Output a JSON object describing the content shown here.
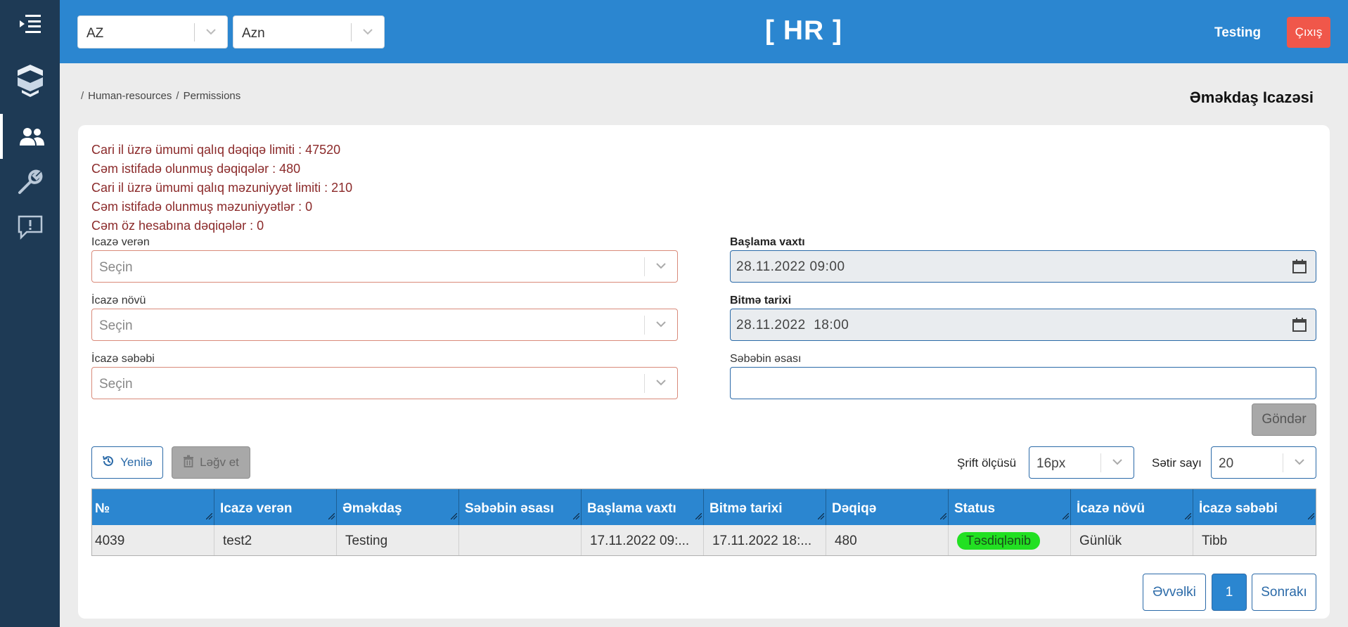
{
  "header": {
    "language_select": "AZ",
    "currency_select": "Azn",
    "title": "[ HR ]",
    "user_name": "Testing",
    "logout_label": "Çıxış"
  },
  "sidebar": {
    "icons": [
      "menu-icon",
      "logo-icon",
      "users-icon",
      "wrench-icon",
      "feedback-icon"
    ]
  },
  "breadcrumb": {
    "items": [
      "Human-resources",
      "Permissions"
    ]
  },
  "page": {
    "title": "Əməkdaş Icazəsi"
  },
  "limits": {
    "line1": "Cari il üzrə ümumi qalıq dəqiqə limiti : 47520",
    "line2": "Cəm istifadə olunmuş dəqiqələr : 480",
    "line3": "Cari il üzrə ümumi qalıq məzuniyyət limiti : 210",
    "line4": "Cəm istifadə olunmuş məzuniyyətlər : 0",
    "line5": "Cəm öz hesabına dəqiqələr : 0"
  },
  "form": {
    "permit_giver_label": "Icazə verən",
    "permit_giver_placeholder": "Seçin",
    "permit_type_label": "İcazə növü",
    "permit_type_placeholder": "Seçin",
    "permit_reason_label": "İcazə səbəbi",
    "permit_reason_placeholder": "Seçin",
    "start_time_label": "Başlama vaxtı",
    "start_time_value": "28.11.2022 09:00",
    "end_date_label": "Bitmə tarixi",
    "end_date_value": "28.11.2022  18:00",
    "reason_basis_label": "Səbəbin əsası",
    "reason_basis_value": "",
    "submit_label": "Göndər"
  },
  "toolbar": {
    "refresh_label": "Yenilə",
    "cancel_label": "Ləğv et",
    "font_size_label": "Şrift ölçüsü",
    "font_size_value": "16px",
    "rows_label": "Sətir sayı",
    "rows_value": "20"
  },
  "table": {
    "columns": [
      "№",
      "Icazə verən",
      "Əməkdaş",
      "Səbəbin əsası",
      "Başlama vaxtı",
      "Bitmə tarixi",
      "Dəqiqə",
      "Status",
      "İcazə növü",
      "İcazə səbəbi"
    ],
    "rows": [
      {
        "no": "4039",
        "giver": "test2",
        "employee": "Testing",
        "basis": "",
        "start": "17.11.2022 09:...",
        "end": "17.11.2022 18:...",
        "minutes": "480",
        "status": "Təsdiqlənib",
        "type": "Günlük",
        "reason": "Tibb"
      }
    ],
    "status_color": "#22e022"
  },
  "pagination": {
    "prev_label": "Əvvəlki",
    "current_page": "1",
    "next_label": "Sonrakı"
  },
  "colors": {
    "header_blue": "#2b86d0",
    "sidebar_navy": "#1e3a55",
    "logout_red": "#f0574a",
    "limits_text": "#8b2a2a"
  }
}
